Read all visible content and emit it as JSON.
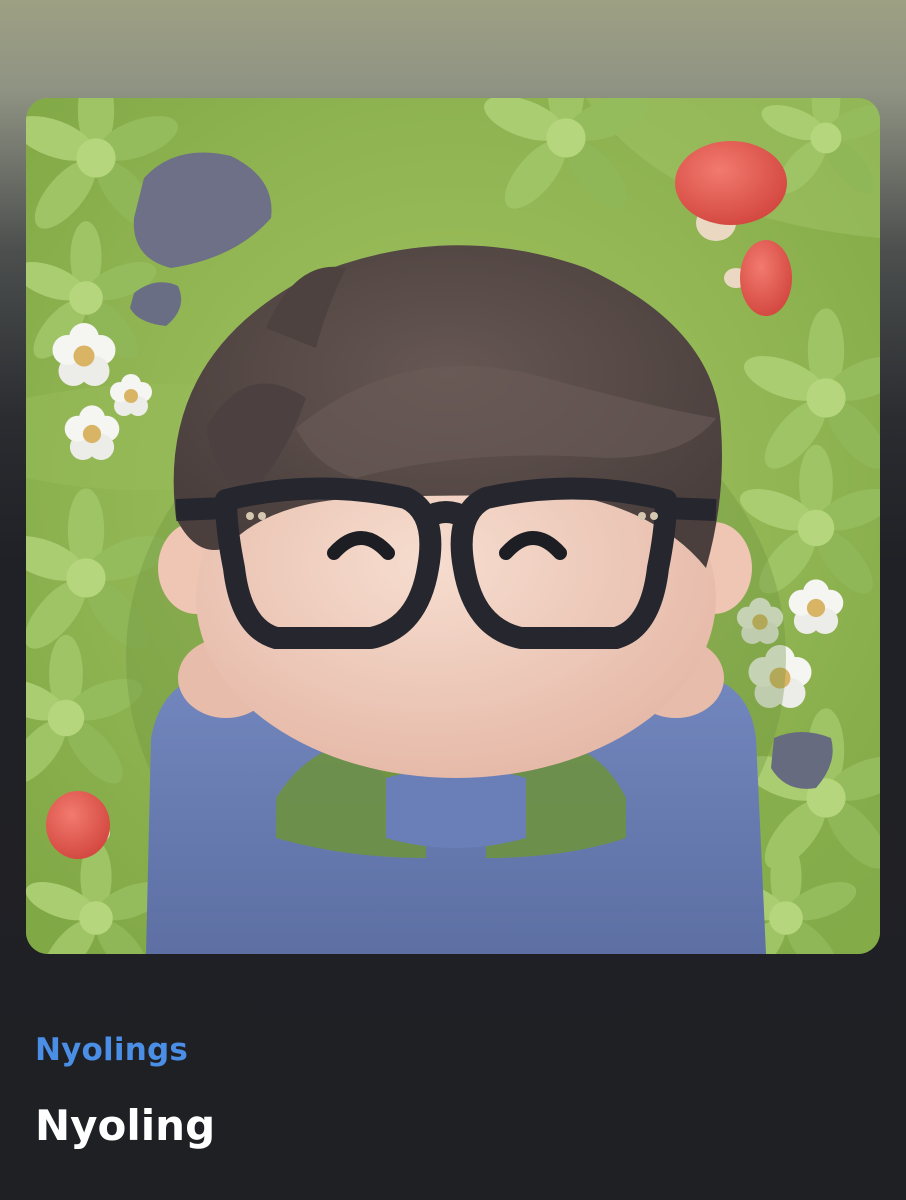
{
  "item": {
    "collection_name": "Nyolings",
    "title": "Nyoling"
  },
  "colors": {
    "collection_link": "#4b8ee6",
    "title": "#ffffff",
    "background": "#1f2024",
    "grass": "#8fb552",
    "shirt": "#6c80b6",
    "hair": "#574a47",
    "glasses": "#25262e",
    "mushroom_cap": "#e8564f"
  }
}
